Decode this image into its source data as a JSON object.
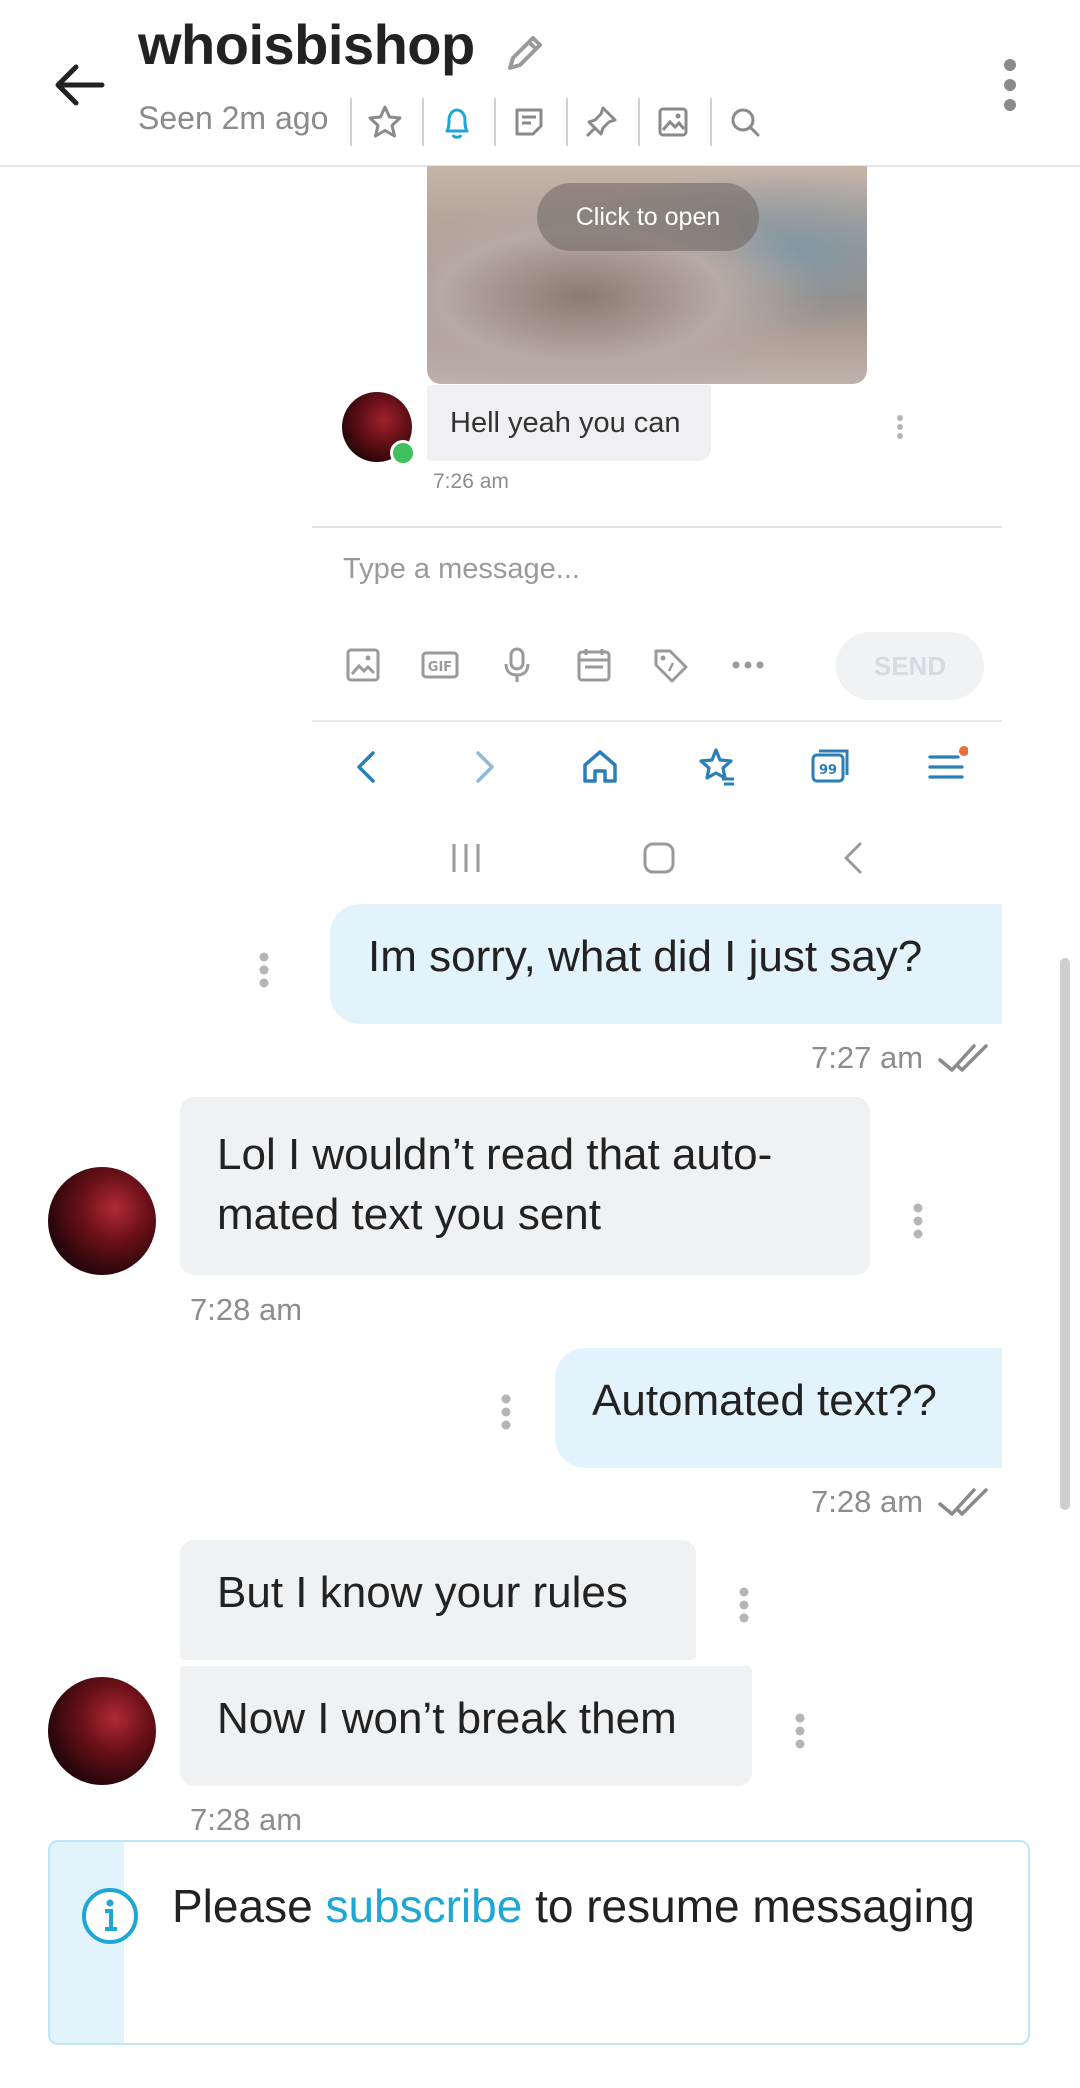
{
  "header": {
    "title": "whoisbishop",
    "status": "Seen 2m ago",
    "toolbar_icons": [
      "star-icon",
      "bell-icon",
      "note-icon",
      "pin-icon",
      "image-icon",
      "search-icon"
    ]
  },
  "embedded_screenshot": {
    "image_overlay_label": "Click to open",
    "message": "Hell yeah you can",
    "message_time": "7:26 am",
    "input_placeholder": "Type a message...",
    "composer_icons": [
      "image-icon",
      "gif-icon",
      "microphone-icon",
      "calendar-icon",
      "tip-tag-icon",
      "more-dots-icon"
    ],
    "gif_label": "GIF",
    "send_label": "SEND",
    "browser_nav_icons": [
      "back-arrow-icon",
      "forward-arrow-icon",
      "home-icon",
      "bookmark-star-icon",
      "tabs-icon",
      "menu-icon"
    ],
    "tabs_count": "99",
    "system_nav_icons": [
      "recents-icon",
      "home-square-icon",
      "back-chevron-icon"
    ]
  },
  "messages": [
    {
      "direction": "out",
      "text": "Im sorry, what did I just say?",
      "time": "7:27 am"
    },
    {
      "direction": "in",
      "lines": [
        "Lol I wouldn’t read that auto-",
        "mated text you sent"
      ],
      "time": "7:28 am"
    },
    {
      "direction": "out",
      "text": "Automated text??",
      "time": "7:28 am"
    },
    {
      "direction": "in",
      "text": "But I know your rules"
    },
    {
      "direction": "in",
      "text": "Now I won’t break them",
      "time": "7:28 am"
    }
  ],
  "banner": {
    "prefix": "Please ",
    "link": "subscribe",
    "suffix": " to resume messaging",
    "accent_color": "#1ea7d6"
  }
}
